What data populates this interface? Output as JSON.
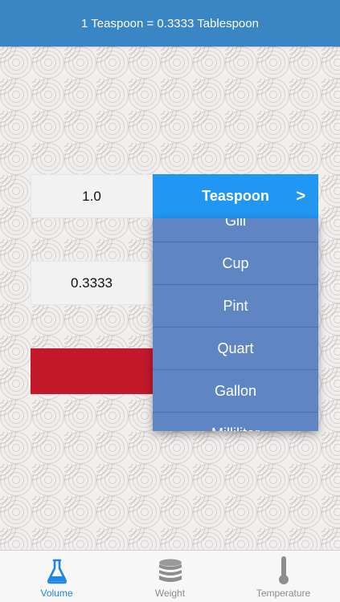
{
  "header": {
    "conversion_text": "1 Teaspoon = 0.3333 Tablespoon"
  },
  "converter": {
    "input_value": "1.0",
    "output_value": "0.3333",
    "selected_unit": "Teaspoon",
    "chevron": ">"
  },
  "dropdown": {
    "items": [
      "Gill",
      "Cup",
      "Pint",
      "Quart",
      "Gallon",
      "Milliliter"
    ]
  },
  "tabbar": {
    "tabs": [
      {
        "label": "Volume",
        "icon": "flask-icon",
        "active": true
      },
      {
        "label": "Weight",
        "icon": "weight-stack-icon",
        "active": false
      },
      {
        "label": "Temperature",
        "icon": "thermometer-icon",
        "active": false
      }
    ]
  },
  "colors": {
    "header": "#3a85c3",
    "unit_button": "#2196f3",
    "dropdown": "#5f86c2",
    "accent_red": "#c2182a",
    "active_tab": "#1e86e6"
  }
}
